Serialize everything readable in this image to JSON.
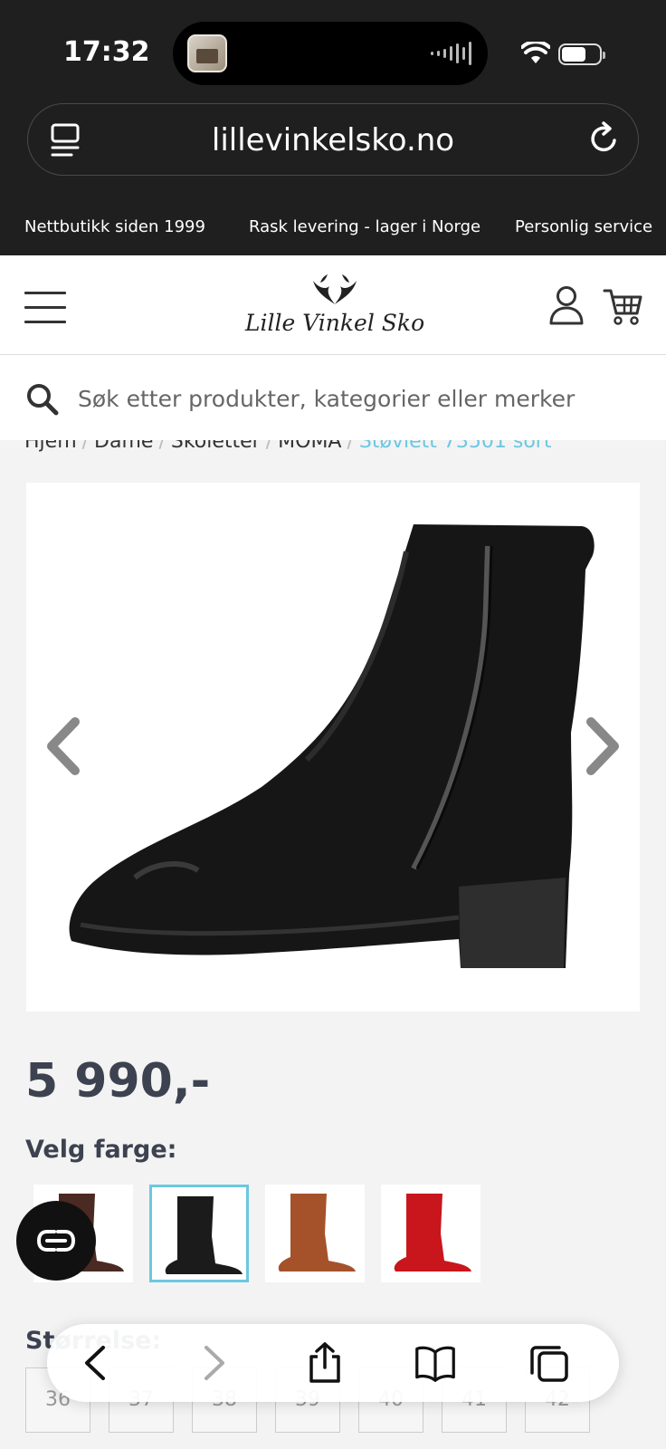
{
  "status_bar": {
    "time": "17:32"
  },
  "browser": {
    "url": "lillevinkelsko.no"
  },
  "usp_bar": {
    "items": [
      "Nettbutikk siden 1999",
      "Rask levering - lager i Norge",
      "Personlig service"
    ]
  },
  "header": {
    "logo_text": "Lille Vinkel Sko"
  },
  "search": {
    "placeholder": "Søk etter produkter, kategorier eller merker"
  },
  "breadcrumb": {
    "items": [
      "Hjem",
      "Dame",
      "Skoletter",
      "MOMA"
    ],
    "current": "Støvlett 73501 sort"
  },
  "product": {
    "price": "5 990,-",
    "color_label": "Velg farge:",
    "size_label": "Størrelse:",
    "colors": [
      {
        "name": "brown",
        "hex": "#4a2a22",
        "selected": false
      },
      {
        "name": "black",
        "hex": "#1b1b1b",
        "selected": true
      },
      {
        "name": "cognac",
        "hex": "#a5522b",
        "selected": false
      },
      {
        "name": "red",
        "hex": "#c8161c",
        "selected": false
      }
    ],
    "sizes": [
      "36",
      "37",
      "38",
      "39",
      "40",
      "41",
      "42"
    ]
  },
  "colors": {
    "accent": "#6cc7e0",
    "text": "#3d4250",
    "dark": "#1f1f1f"
  }
}
